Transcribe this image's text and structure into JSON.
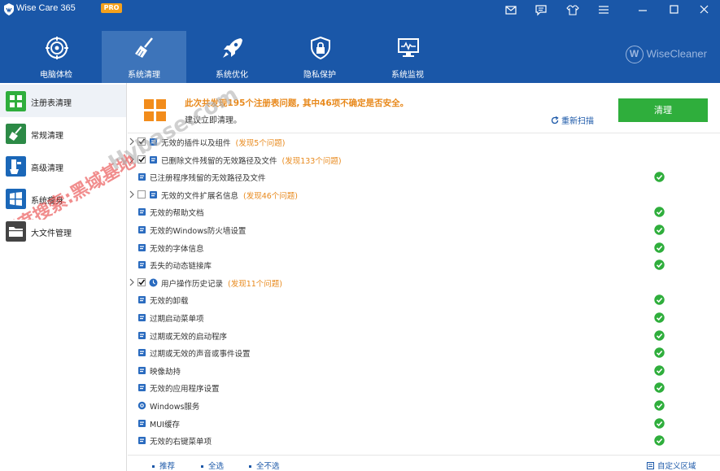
{
  "app": {
    "title": "Wise Care 365",
    "badge": "PRO"
  },
  "nav": {
    "items": [
      {
        "label": "电脑体检",
        "icon": "target-icon"
      },
      {
        "label": "系统清理",
        "icon": "broom-icon"
      },
      {
        "label": "系统优化",
        "icon": "rocket-icon"
      },
      {
        "label": "隐私保护",
        "icon": "shield-lock-icon"
      },
      {
        "label": "系统监视",
        "icon": "monitor-icon"
      }
    ],
    "active": 1,
    "brand": "WiseCleaner",
    "brand_mark": "W"
  },
  "sidebar": {
    "items": [
      {
        "label": "注册表清理",
        "color": "#2fae3c"
      },
      {
        "label": "常规清理",
        "color": "#2c8a46"
      },
      {
        "label": "高级清理",
        "color": "#1a67b8"
      },
      {
        "label": "系统瘦身",
        "color": "#1a67b8"
      },
      {
        "label": "大文件管理",
        "color": "#444444"
      }
    ]
  },
  "banner": {
    "message": "此次共发现195个注册表问题, 其中46项不确定是否安全。",
    "sub": "建议立即清理。",
    "rescan": "重新扫描",
    "clean": "清理"
  },
  "rows": [
    {
      "label": "无效的插件以及组件",
      "count": "(发现5个问题)",
      "expand": true,
      "checked": true,
      "ok": false
    },
    {
      "label": "已删除文件残留的无效路径及文件",
      "count": "(发现133个问题)",
      "expand": true,
      "checked": true,
      "ok": false
    },
    {
      "label": "已注册程序残留的无效路径及文件",
      "count": "",
      "expand": false,
      "checked": false,
      "ok": true
    },
    {
      "label": "无效的文件扩展名信息",
      "count": "(发现46个问题)",
      "expand": true,
      "checked": false,
      "ok": false
    },
    {
      "label": "无效的帮助文档",
      "count": "",
      "expand": false,
      "checked": false,
      "ok": true
    },
    {
      "label": "无效的Windows防火墙设置",
      "count": "",
      "expand": false,
      "checked": false,
      "ok": true
    },
    {
      "label": "无效的字体信息",
      "count": "",
      "expand": false,
      "checked": false,
      "ok": true
    },
    {
      "label": "丢失的动态链接库",
      "count": "",
      "expand": false,
      "checked": false,
      "ok": true
    },
    {
      "label": "用户操作历史记录",
      "count": "(发现11个问题)",
      "expand": true,
      "checked": true,
      "ok": false
    },
    {
      "label": "无效的卸载",
      "count": "",
      "expand": false,
      "checked": false,
      "ok": true
    },
    {
      "label": "过期启动菜单项",
      "count": "",
      "expand": false,
      "checked": false,
      "ok": true
    },
    {
      "label": "过期或无效的启动程序",
      "count": "",
      "expand": false,
      "checked": false,
      "ok": true
    },
    {
      "label": "过期或无效的声音或事件设置",
      "count": "",
      "expand": false,
      "checked": false,
      "ok": true
    },
    {
      "label": "映像劫持",
      "count": "",
      "expand": false,
      "checked": false,
      "ok": true
    },
    {
      "label": "无效的应用程序设置",
      "count": "",
      "expand": false,
      "checked": false,
      "ok": true
    },
    {
      "label": "Windows服务",
      "count": "",
      "expand": false,
      "checked": false,
      "ok": true
    },
    {
      "label": "MUI缓存",
      "count": "",
      "expand": false,
      "checked": false,
      "ok": true
    },
    {
      "label": "无效的右键菜单项",
      "count": "",
      "expand": false,
      "checked": false,
      "ok": true
    }
  ],
  "footer": {
    "recommend": "推荐",
    "select_all": "全选",
    "select_none": "全不选",
    "custom_area": "自定义区域"
  },
  "watermark": {
    "line1": "百度搜索:黑域基地",
    "line2": "Hybase.com"
  },
  "colors": {
    "accent": "#1a57a8",
    "green": "#2fae3c",
    "orange": "#e8891c"
  }
}
